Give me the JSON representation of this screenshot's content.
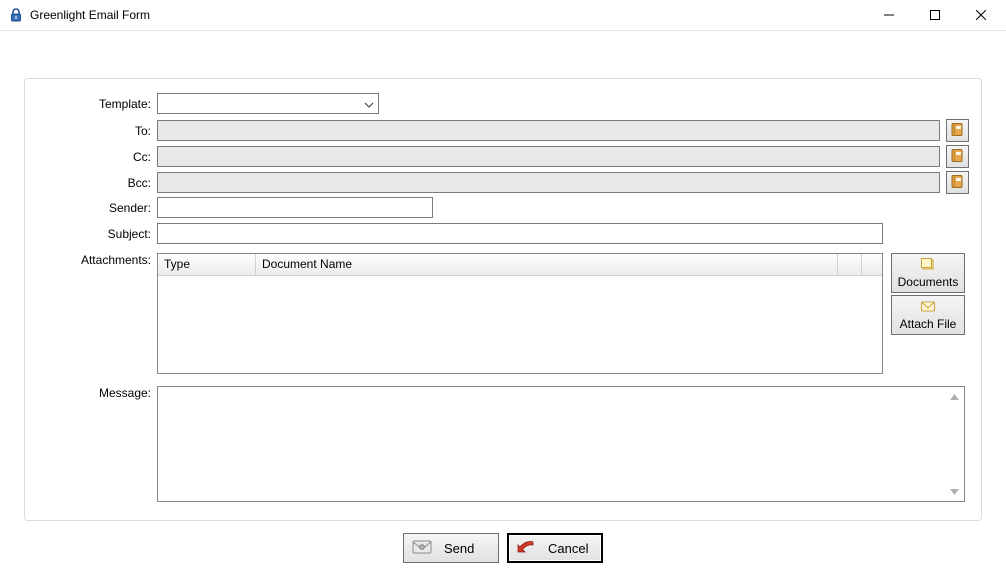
{
  "window": {
    "title": "Greenlight Email Form"
  },
  "labels": {
    "template": "Template:",
    "to": "To:",
    "cc": "Cc:",
    "bcc": "Bcc:",
    "sender": "Sender:",
    "subject": "Subject:",
    "attachments": "Attachments:",
    "message": "Message:"
  },
  "fields": {
    "template": "",
    "to": "",
    "cc": "",
    "bcc": "",
    "sender": "",
    "subject": "",
    "message": ""
  },
  "attachments": {
    "columns": {
      "type": "Type",
      "document_name": "Document Name"
    },
    "rows": []
  },
  "buttons": {
    "documents": "Documents",
    "attach_file": "Attach File",
    "send": "Send",
    "cancel": "Cancel"
  }
}
